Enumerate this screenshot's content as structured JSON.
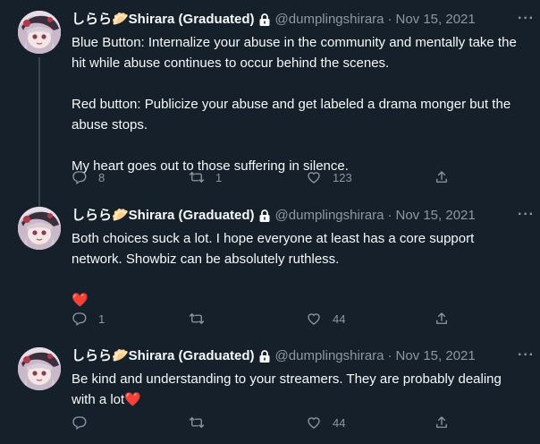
{
  "author": {
    "name": "しらら🥟Shirara (Graduated)",
    "handle": "@dumplingshirara",
    "separator": "·"
  },
  "tweets": [
    {
      "date": "Nov 15, 2021",
      "paragraphs": [
        "Blue Button: Internalize your abuse in the community and mentally take the hit while abuse continues to occur behind the scenes.",
        "Red button: Publicize your abuse and get labeled a drama monger but the abuse stops.",
        "My heart goes out to those suffering in silence."
      ],
      "replies": "8",
      "retweets": "1",
      "likes": "123"
    },
    {
      "date": "Nov 15, 2021",
      "paragraphs": [
        "Both choices suck a lot. I hope everyone at least has a core support network. Showbiz can be absolutely ruthless."
      ],
      "emoji": "❤️",
      "replies": "1",
      "retweets": "",
      "likes": "44"
    },
    {
      "date": "Nov 15, 2021",
      "paragraphs": [
        "Be kind and understanding to your streamers. They are probably dealing with a lot❤️"
      ],
      "replies": "",
      "retweets": "",
      "likes": "44"
    }
  ],
  "icons": {
    "more": "more-icon",
    "reply": "reply-icon",
    "retweet": "retweet-icon",
    "like": "like-icon",
    "share": "share-icon",
    "lock": "lock-icon"
  },
  "colors": {
    "background": "#15202b",
    "text": "#f7f9f9",
    "muted": "#8b98a5",
    "thread_line": "#38444d"
  }
}
